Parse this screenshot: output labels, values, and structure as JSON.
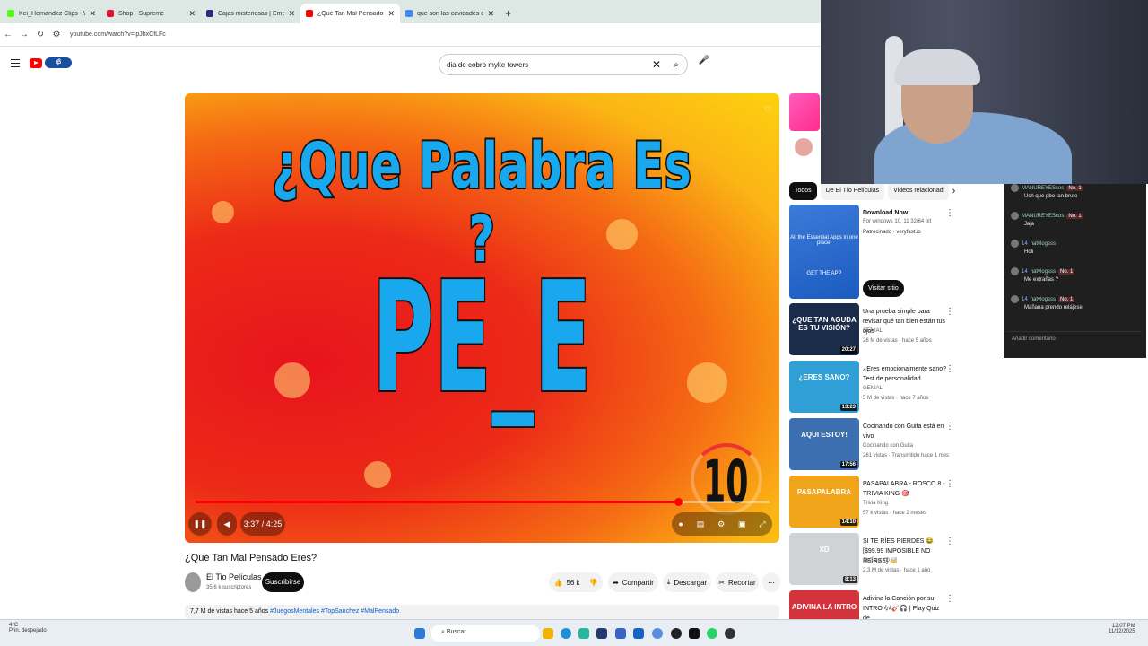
{
  "browser": {
    "tabs": [
      {
        "label": "Kei_Hernandez Clips - Watch t",
        "color": "#53fc18"
      },
      {
        "label": "Shop - Supreme",
        "color": "#e8112d"
      },
      {
        "label": "Cajas misteriosas | EmpireDrop",
        "color": "#2b2d7c"
      },
      {
        "label": "¿Qué Tan Mal Pensado Eres?",
        "color": "#ff0000",
        "active": true
      },
      {
        "label": "que son las cavidades del coraz",
        "color": "#4285f4"
      }
    ],
    "url": "youtube.com/watch?v=lpJhxCfLFc"
  },
  "youtube": {
    "logo_badge": "ιβ",
    "search_value": "dia de cobro myke towers",
    "video": {
      "headline": "¿Que Palabra Es ?",
      "word": "PE_E",
      "countdown": "10",
      "time": "3:37 / 4:25",
      "progress": 0.84
    },
    "title": "¿Qué Tan Mal Pensado Eres?",
    "channel": "El Tio Películas",
    "subscribers": "35,6 k suscriptores",
    "subscribe_label": "Suscribirse",
    "likes": "56 k",
    "share": "Compartir",
    "download": "Descargar",
    "clip": "Recortar",
    "desc_stats": "7,7 M de vistas  hace 5 años",
    "desc_tags": "#JuegosMentales #TopSanchez #MalPensado",
    "chips": [
      "Todos",
      "De El Tío Películas",
      "Videos relacionad"
    ],
    "ad": {
      "title": "Download Now",
      "line1": "For windows 10, 11 32/64 bit",
      "sponsor": "Patrocinado · veryfast.io",
      "visit": "Visitar sitio",
      "thumb_text": "All the Essential Apps in one place!",
      "thumb_btn": "GET THE APP"
    },
    "recs": [
      {
        "title": "Una prueba simple para revisar qué tan bien están tus ojos",
        "channel": "GENIAL",
        "meta": "26 M de vistas · hace 5 años",
        "duration": "20:27",
        "thumb": "¿QUE TAN AGUDA ES TU VISIÓN?",
        "bg": "#1b2c4a"
      },
      {
        "title": "¿Eres emocionalmente sano? Test de personalidad",
        "channel": "GENIAL",
        "meta": "5 M de vistas · hace 7 años",
        "duration": "13:23",
        "thumb": "¿ERES SANO?",
        "bg": "#2f9fd6"
      },
      {
        "title": "Cocinando con Guita está en vivo",
        "channel": "Cocinando con Guita",
        "meta": "261 vistas · Transmitido hace 1 mes",
        "duration": "17:56",
        "thumb": "AQUI ESTOY!",
        "bg": "#3c6fb0"
      },
      {
        "title": "PASAPALABRA - ROSCO 8 - TRIVIA KING 🎯",
        "channel": "Trivia King",
        "meta": "57 k vistas · hace 2 meses",
        "duration": "14:10",
        "thumb": "PASAPALABRA",
        "bg": "#f0a51a"
      },
      {
        "title": "SI TE RÍES PIERDES 😂 [$99.99 IMPOSIBLE NO REÍRSE] 🤯",
        "channel": "El Gato XD",
        "meta": "2,3 M de vistas · hace 1 año",
        "duration": "8:13",
        "thumb": "XD",
        "bg": "#cfd3d6"
      },
      {
        "title": "Adivina la Canción por su INTRO 🎶🎸🎧 | Play Quiz de...",
        "channel": "",
        "meta": "",
        "duration": "",
        "thumb": "ADIVINA LA INTRO",
        "bg": "#d3333a"
      }
    ]
  },
  "chat": {
    "messages": [
      {
        "user": "MANUREYESco​s",
        "badge": "No. 1",
        "text": "Ush que pbo tan bruto"
      },
      {
        "user": "MANUREYESco​s",
        "badge": "No. 1",
        "text": "Jaja"
      },
      {
        "user": "natvlogsss",
        "badge": "",
        "level": "14",
        "text": "Holi"
      },
      {
        "user": "natvlogsss",
        "badge": "No. 1",
        "level": "14",
        "text": "Me extrañas ?"
      },
      {
        "user": "natvlogsss",
        "badge": "No. 1",
        "level": "14",
        "text": "Mañana prendo relájese"
      }
    ],
    "placeholder": "Añadir comentario"
  },
  "taskbar": {
    "temp": "4°C",
    "weather": "Prin. despejado",
    "search": "Buscar",
    "time": "12:07 PM",
    "date": "11/12/2025"
  }
}
